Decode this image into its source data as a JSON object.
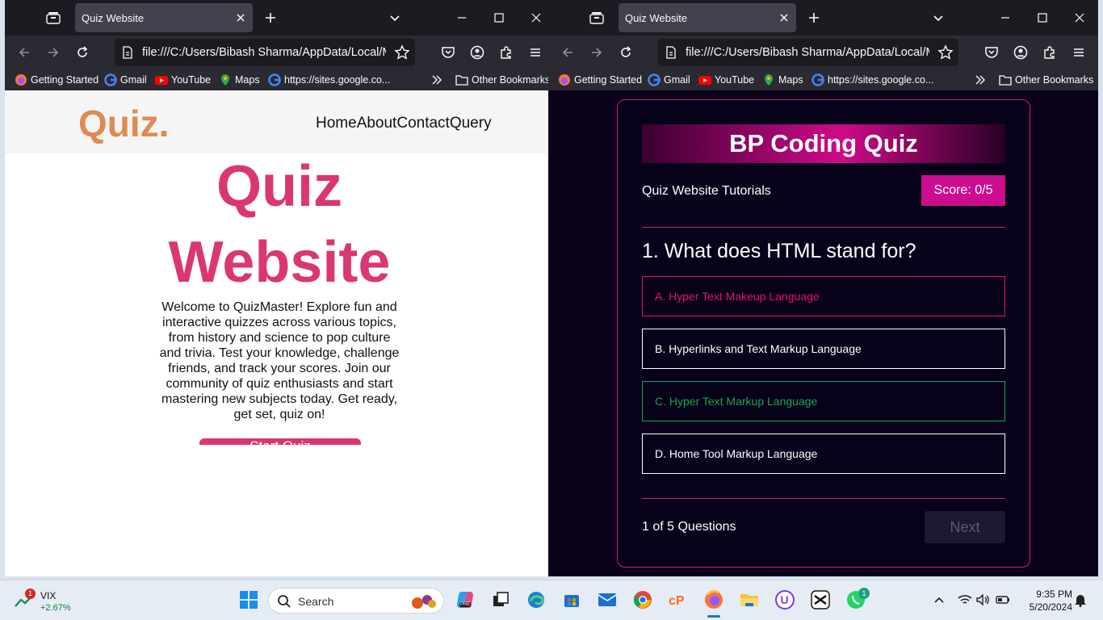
{
  "left_browser": {
    "tab_title": "Quiz Website",
    "url": "file:///C:/Users/Bibash Sharma/AppData/Local/Mic",
    "bookmarks": [
      "Getting Started",
      "Gmail",
      "YouTube",
      "Maps",
      "https://sites.google.co..."
    ],
    "other_bookmarks": "Other Bookmarks"
  },
  "right_browser": {
    "tab_title": "Quiz Website",
    "url": "file:///C:/Users/Bibash Sharma/AppData/Local/Mic",
    "bookmarks": [
      "Getting Started",
      "Gmail",
      "YouTube",
      "Maps",
      "https://sites.google.co..."
    ],
    "other_bookmarks": "Other Bookmarks"
  },
  "landing": {
    "logo": "Quiz.",
    "nav": [
      "Home",
      "About",
      "Contact",
      "Query"
    ],
    "hero_title_line1": "Quiz",
    "hero_title_line2": "Website",
    "hero_text": "Welcome to QuizMaster! Explore fun and interactive quizzes across various topics, from history and science to pop culture and trivia. Test your knowledge, challenge friends, and track your scores. Join our community of quiz enthusiasts and start mastering new subjects today. Get ready, get set, quiz on!",
    "start_button": "Start Quiz"
  },
  "quiz": {
    "title": "BP Coding Quiz",
    "subtitle": "Quiz Website Tutorials",
    "score": "Score: 0/5",
    "question": "1. What does HTML stand for?",
    "options": [
      {
        "label": "A. Hyper Text Makeup Language",
        "state": "wrong"
      },
      {
        "label": "B. Hyperlinks and Text Markup Language",
        "state": "neutral"
      },
      {
        "label": "C. Hyper Text Markup Language",
        "state": "correct"
      },
      {
        "label": "D. Home Tool Markup Language",
        "state": "neutral"
      }
    ],
    "progress": "1 of 5 Questions",
    "next_button": "Next"
  },
  "taskbar": {
    "widget_name": "VIX",
    "widget_value": "+2.67%",
    "widget_badge": "1",
    "search_placeholder": "Search",
    "time": "9:35 PM",
    "date": "5/20/2024",
    "whatsapp_badge": "1",
    "copilot_tag": "PRE"
  },
  "colors": {
    "accent_pink": "#db3674",
    "logo_orange": "#e08a53",
    "quiz_magenta": "#cc0d8f",
    "wrong_red": "#e0175f",
    "correct_green": "#13a84d"
  }
}
